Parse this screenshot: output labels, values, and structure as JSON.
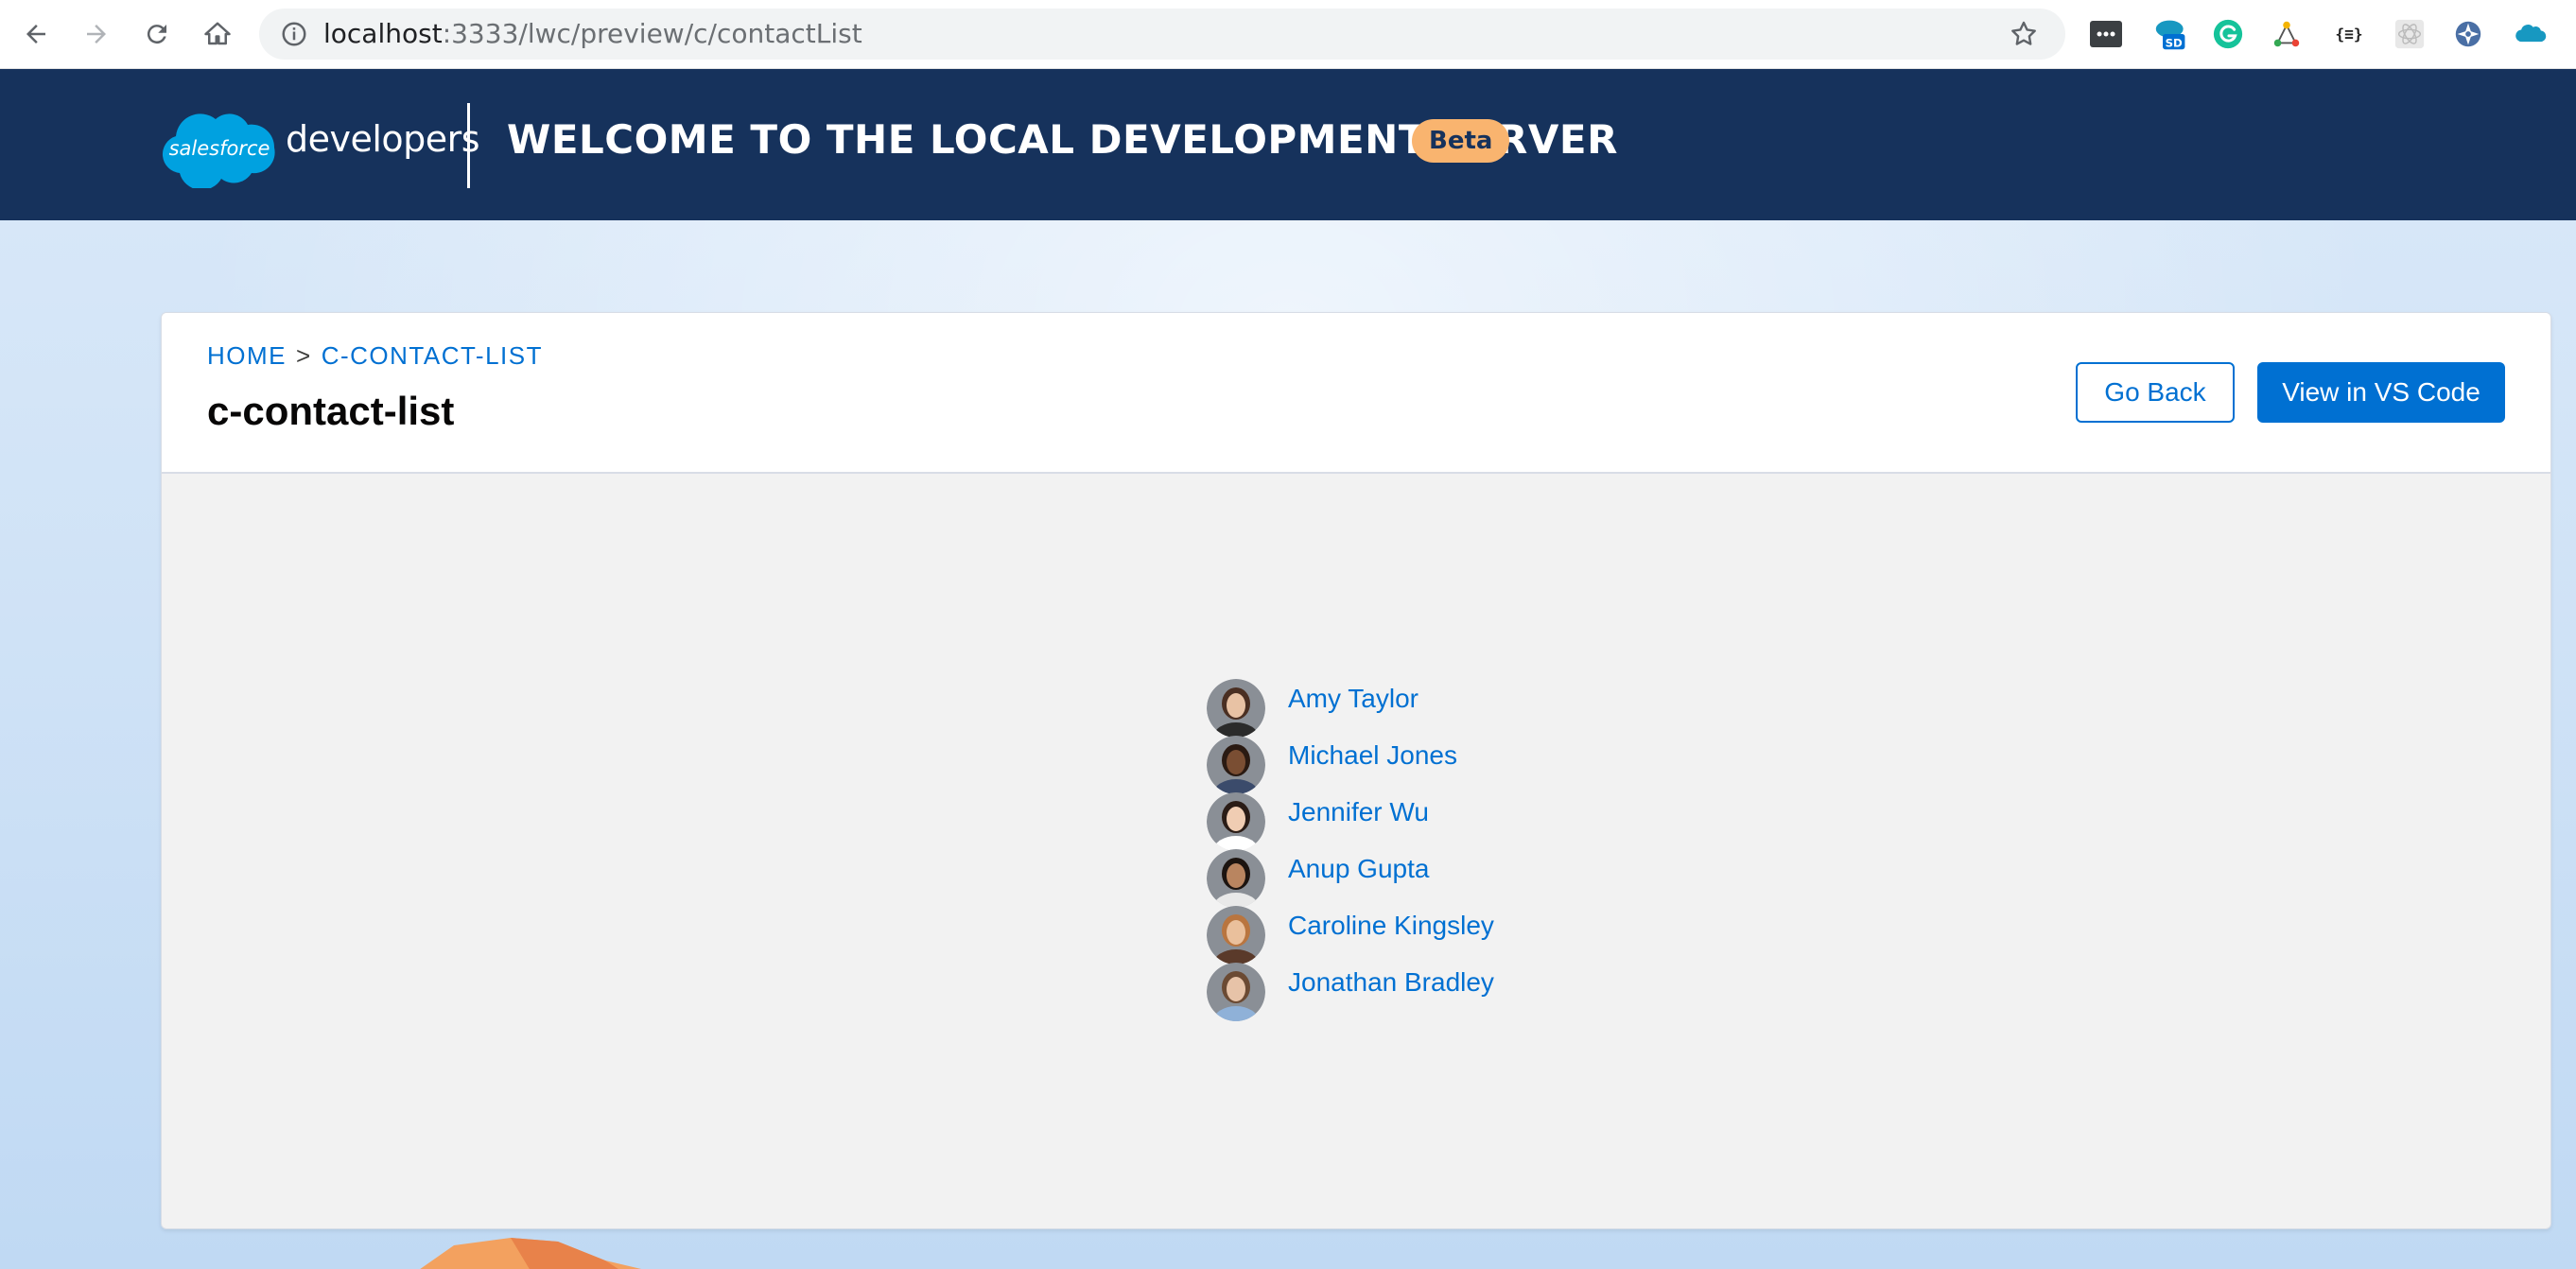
{
  "browser": {
    "url_host": "localhost",
    "url_rest": ":3333/lwc/preview/c/contactList",
    "extensions": [
      "terminal-extension-icon",
      "salesforce-sd-extension-icon",
      "grammarly-icon",
      "network-extension-icon",
      "json-formatter-icon",
      "react-devtools-icon",
      "sync-extension-icon",
      "salesforce-inspector-icon"
    ],
    "ext_sd_label": "SD",
    "ext_json_label": "{≡}"
  },
  "header": {
    "logo_text": "salesforce",
    "brand_suffix": "developers",
    "title": "WELCOME TO THE LOCAL DEVELOPMENT SERVER",
    "badge": "Beta"
  },
  "card": {
    "breadcrumb": {
      "home": "HOME",
      "separator": ">",
      "current": "C-CONTACT-LIST"
    },
    "title": "c-contact-list",
    "go_back_label": "Go Back",
    "vs_code_label": "View in VS Code"
  },
  "contacts": [
    {
      "name": "Amy Taylor",
      "skin": "#e8c2a4",
      "hair": "#4a2f22",
      "shirt": "#2b2b2b"
    },
    {
      "name": "Michael Jones",
      "skin": "#7a4e33",
      "hair": "#2a1a12",
      "shirt": "#3b4b6b"
    },
    {
      "name": "Jennifer Wu",
      "skin": "#f0cdb3",
      "hair": "#2a1c16",
      "shirt": "#ffffff"
    },
    {
      "name": "Anup Gupta",
      "skin": "#b98560",
      "hair": "#1c1410",
      "shirt": "#e9e9e9"
    },
    {
      "name": "Caroline Kingsley",
      "skin": "#eac09c",
      "hair": "#b9753f",
      "shirt": "#5a3a2a"
    },
    {
      "name": "Jonathan Bradley",
      "skin": "#e7c3a8",
      "hair": "#6b4a33",
      "shirt": "#8fb1d8"
    }
  ],
  "colors": {
    "header_bg": "#16325c",
    "brand_blue": "#0070d2",
    "beta_badge": "#f9b46f",
    "card_body": "#f2f2f2"
  }
}
